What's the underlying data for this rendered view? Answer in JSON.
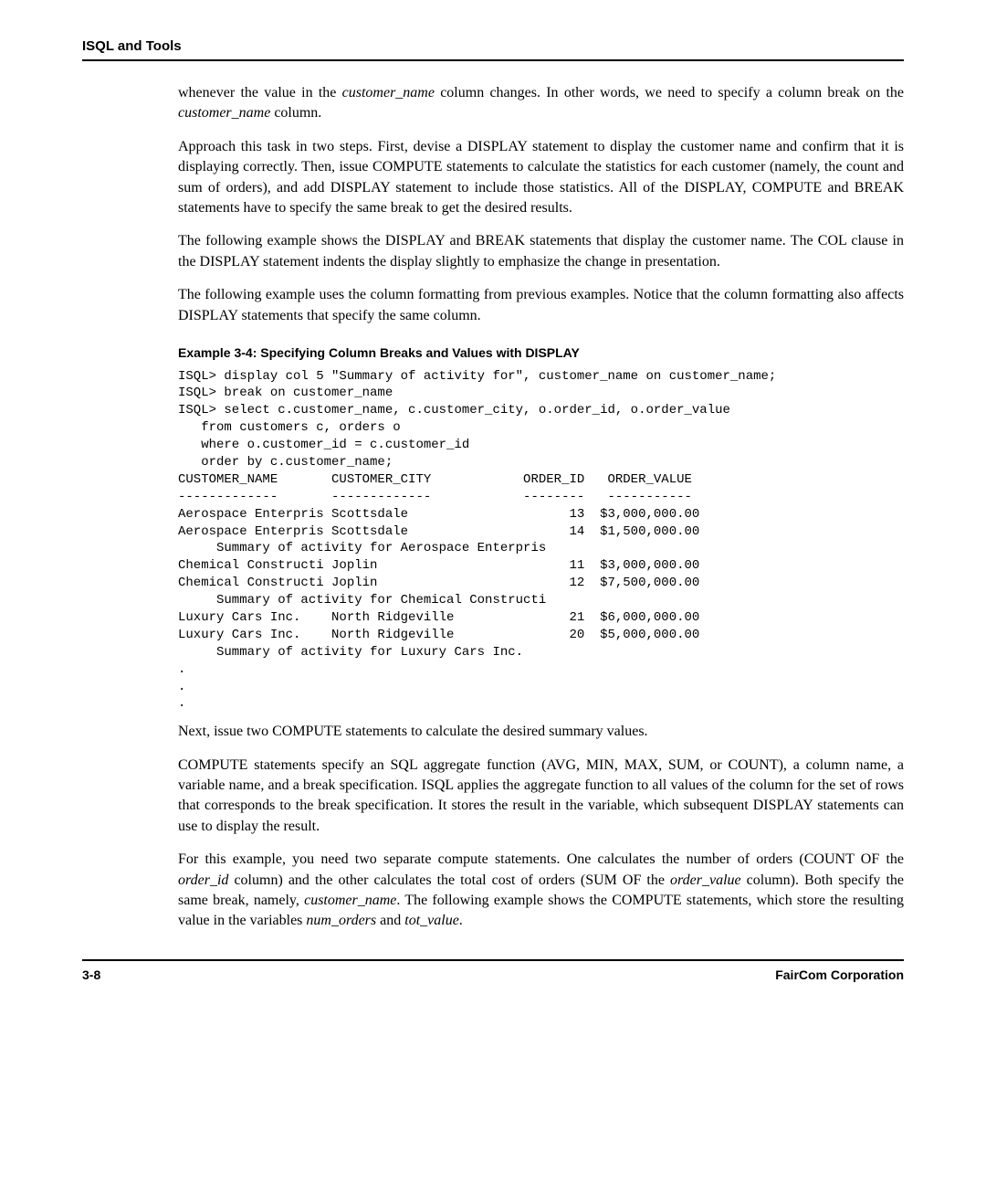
{
  "header": {
    "title": "ISQL and Tools"
  },
  "body": {
    "p1_pre": "whenever the value in the ",
    "p1_em1": "customer_name",
    "p1_mid": " column changes. In other words, we need to specify a column break on the ",
    "p1_em2": "customer_name",
    "p1_post": " column.",
    "p2": "Approach this task in two steps. First, devise a DISPLAY statement to display the customer name and confirm that it is displaying correctly. Then, issue COMPUTE statements to calculate the statistics for each customer (namely, the count and sum of orders), and add DISPLAY statement to include those statistics. All of the DISPLAY, COMPUTE and BREAK statements have to specify the same break to get the desired results.",
    "p3": "The following example shows the DISPLAY and BREAK statements that display the customer name. The COL clause in the DISPLAY statement indents the display slightly to emphasize the change in presentation.",
    "p4": "The following example uses the column formatting from previous examples. Notice that the column formatting also affects DISPLAY statements that specify the same column.",
    "example_caption": "Example 3-4:  Specifying Column Breaks and Values with DISPLAY",
    "code": "ISQL> display col 5 \"Summary of activity for\", customer_name on customer_name;\nISQL> break on customer_name\nISQL> select c.customer_name, c.customer_city, o.order_id, o.order_value\n   from customers c, orders o\n   where o.customer_id = c.customer_id\n   order by c.customer_name;\nCUSTOMER_NAME       CUSTOMER_CITY            ORDER_ID   ORDER_VALUE\n-------------       -------------            --------   -----------\nAerospace Enterpris Scottsdale                     13  $3,000,000.00\nAerospace Enterpris Scottsdale                     14  $1,500,000.00\n     Summary of activity for Aerospace Enterpris\nChemical Constructi Joplin                         11  $3,000,000.00\nChemical Constructi Joplin                         12  $7,500,000.00\n     Summary of activity for Chemical Constructi\nLuxury Cars Inc.    North Ridgeville               21  $6,000,000.00\nLuxury Cars Inc.    North Ridgeville               20  $5,000,000.00\n     Summary of activity for Luxury Cars Inc.\n.\n.\n.",
    "p5": "Next, issue two COMPUTE statements to calculate the desired summary values.",
    "p6": "COMPUTE statements specify an SQL aggregate function (AVG, MIN, MAX, SUM, or COUNT), a column name, a variable name, and a break specification. ISQL applies the aggregate function to all values of the column for the set of rows that corresponds to the break specification. It stores the result in the variable, which subsequent DISPLAY statements can use to display the result.",
    "p7_1": "For this example, you need two separate compute statements. One calculates the number of orders (COUNT OF the ",
    "p7_em1": "order_id",
    "p7_2": " column) and the other calculates the total cost of orders (SUM OF the ",
    "p7_em2": "order_value",
    "p7_3": " column). Both specify the same break, namely, ",
    "p7_em3": "customer_name",
    "p7_4": ". The following example shows the COMPUTE statements, which store the resulting value in the variables ",
    "p7_em4": "num_orders",
    "p7_5": " and ",
    "p7_em5": "tot_value",
    "p7_6": "."
  },
  "footer": {
    "page_number": "3-8",
    "company": "FairCom Corporation"
  }
}
